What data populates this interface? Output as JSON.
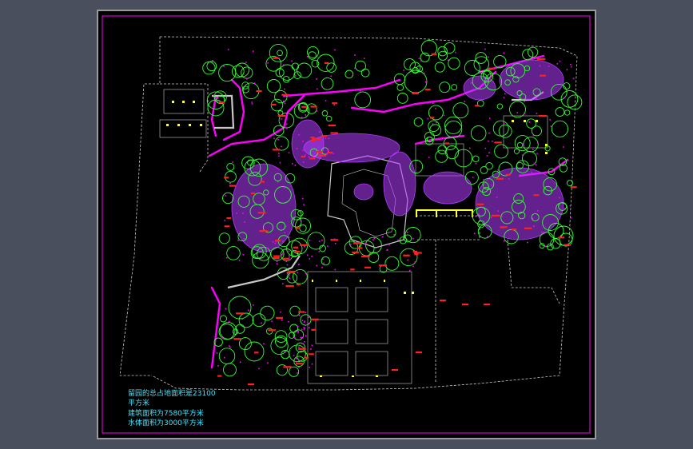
{
  "viewport": {
    "background": "#4a4f5e"
  },
  "drawing": {
    "background": "#000000",
    "border_color": "#9a9a9a",
    "frame_color": "#ff00ff",
    "colors": {
      "trees": "#33ff33",
      "shrubs": "#b23cff",
      "paths": "#ff00ff",
      "labels": "#ff2020",
      "walls": "#c8c8c8",
      "buildings_highlight": "#ffff33",
      "text": "#3fe6ff"
    },
    "notes": [
      "留园的总占地面积是23100",
      "平方米",
      "建筑面积为7580平方米",
      "水体面积为3000平方米"
    ]
  }
}
